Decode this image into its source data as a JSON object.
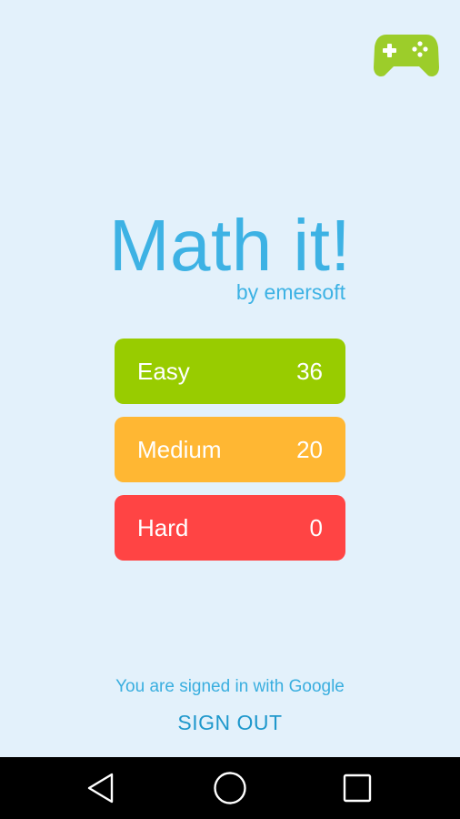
{
  "header": {
    "games_icon": "game-controller-icon",
    "games_icon_color": "#9ccd2a"
  },
  "title": {
    "app_name": "Math it!",
    "subtitle": "by emersoft",
    "color": "#3db2e4"
  },
  "levels": [
    {
      "label": "Easy",
      "score": "36",
      "color": "#98cc00"
    },
    {
      "label": "Medium",
      "score": "20",
      "color": "#ffb733"
    },
    {
      "label": "Hard",
      "score": "0",
      "color": "#ff4444"
    }
  ],
  "account": {
    "status_text": "You are signed in with Google",
    "sign_out_label": "SIGN OUT"
  },
  "nav_bar": {
    "back_icon": "back-triangle-icon",
    "home_icon": "home-circle-icon",
    "recents_icon": "recents-square-icon"
  }
}
